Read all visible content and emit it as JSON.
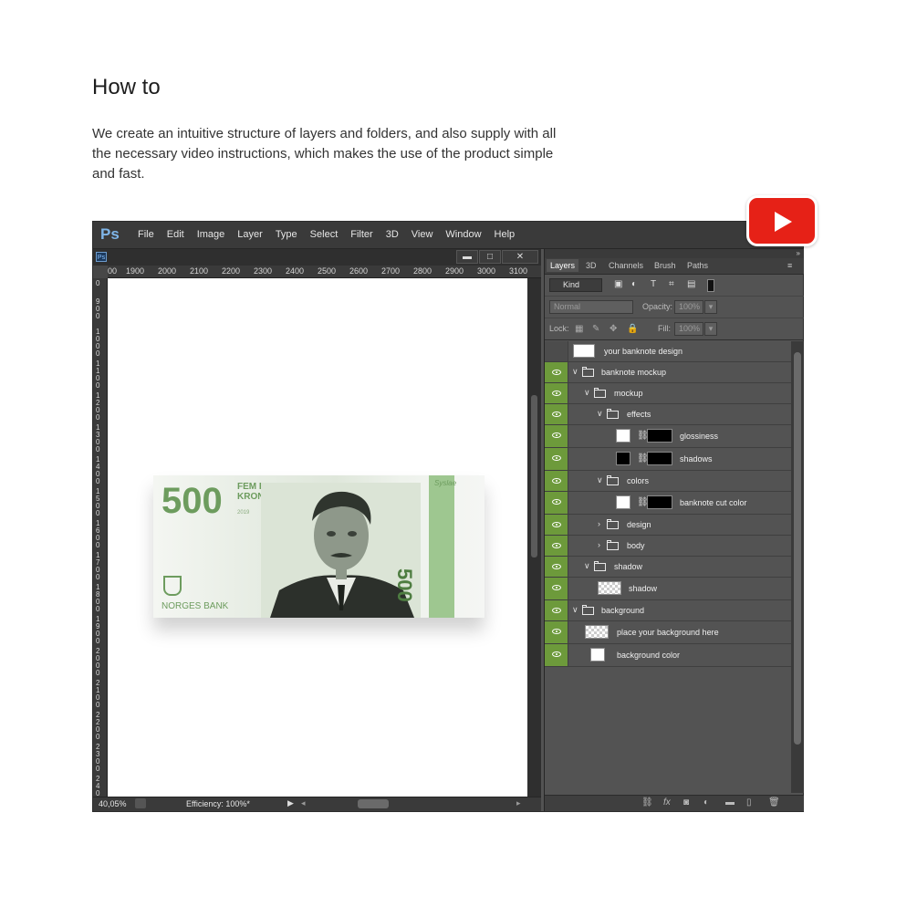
{
  "heading": "How to",
  "description": "We create an intuitive structure of layers and folders, and also supply with all the necessary video instructions, which makes the use of the product simple and fast.",
  "ps": {
    "logo": "Ps",
    "menu": [
      "File",
      "Edit",
      "Image",
      "Layer",
      "Type",
      "Select",
      "Filter",
      "3D",
      "View",
      "Window",
      "Help"
    ],
    "window_buttons": {
      "minimize": "▬",
      "restore": "□",
      "close": "✕"
    },
    "ruler_top": [
      "00",
      "1900",
      "2000",
      "2100",
      "2200",
      "2300",
      "2400",
      "2500",
      "2600",
      "2700",
      "2800",
      "2900",
      "3000",
      "3100"
    ],
    "ruler_left": [
      "0",
      "900",
      "1000",
      "1100",
      "1200",
      "1300",
      "1400",
      "1500",
      "1600",
      "1700",
      "1800",
      "1900",
      "2000",
      "2100",
      "2200",
      "2300",
      "240"
    ],
    "status": {
      "zoom": "40,05%",
      "efficiency": "Efficiency: 100%*"
    },
    "banknote": {
      "value": "500",
      "words": "FEM HUNDRE KRONER",
      "year": "2019",
      "bank": "NORGES BANK",
      "vertical_value": "500",
      "signature": "Syslae"
    }
  },
  "panel": {
    "tabs": [
      "Layers",
      "3D",
      "Channels",
      "Brush",
      "Paths"
    ],
    "active_tab": "Layers",
    "kind": "Kind",
    "blend_mode": "Normal",
    "opacity_label": "Opacity:",
    "opacity_value": "100%",
    "lock_label": "Lock:",
    "fill_label": "Fill:",
    "fill_value": "100%",
    "layers": [
      {
        "name": "your banknote design",
        "visible": false,
        "type": "smart"
      },
      {
        "name": "banknote mockup",
        "visible": true,
        "type": "folder"
      },
      {
        "name": "mockup",
        "visible": true,
        "type": "folder"
      },
      {
        "name": "effects",
        "visible": true,
        "type": "folder"
      },
      {
        "name": "glossiness",
        "visible": true,
        "type": "masked-white"
      },
      {
        "name": "shadows",
        "visible": true,
        "type": "masked-black"
      },
      {
        "name": "colors",
        "visible": true,
        "type": "folder"
      },
      {
        "name": "banknote cut color",
        "visible": true,
        "type": "masked-white"
      },
      {
        "name": "design",
        "visible": true,
        "type": "folder-closed"
      },
      {
        "name": "body",
        "visible": true,
        "type": "folder-closed"
      },
      {
        "name": "shadow",
        "visible": true,
        "type": "folder"
      },
      {
        "name": "shadow",
        "visible": true,
        "type": "checker"
      },
      {
        "name": "background",
        "visible": true,
        "type": "folder"
      },
      {
        "name": "place your background here",
        "visible": true,
        "type": "checker"
      },
      {
        "name": "background color",
        "visible": true,
        "type": "white"
      }
    ]
  },
  "colors": {
    "accent_green": "#6d9a3b",
    "youtube_red": "#e62117",
    "note_green": "#6d9c5e"
  }
}
